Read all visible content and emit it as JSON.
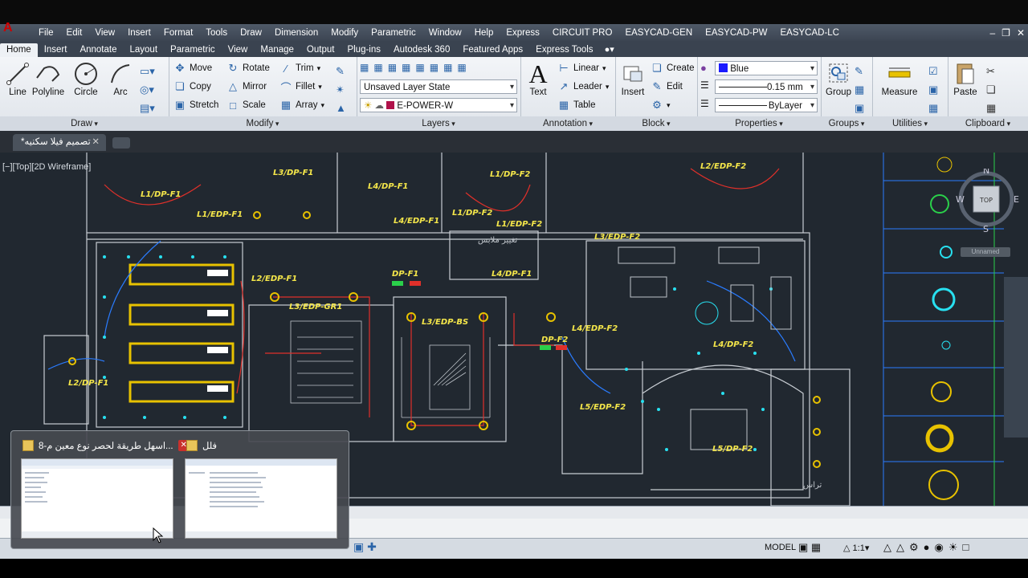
{
  "menu": {
    "items": [
      "File",
      "Edit",
      "View",
      "Insert",
      "Format",
      "Tools",
      "Draw",
      "Dimension",
      "Modify",
      "Parametric",
      "Window",
      "Help",
      "Express",
      "CIRCUIT PRO",
      "EASYCAD-GEN",
      "EASYCAD-PW",
      "EASYCAD-LC"
    ]
  },
  "ribbon_tabs": [
    "Home",
    "Insert",
    "Annotate",
    "Layout",
    "Parametric",
    "View",
    "Manage",
    "Output",
    "Plug-ins",
    "Autodesk 360",
    "Featured Apps",
    "Express Tools"
  ],
  "ribbon": {
    "draw": {
      "title": "Draw",
      "line": "Line",
      "polyline": "Polyline",
      "circle": "Circle",
      "arc": "Arc"
    },
    "modify": {
      "title": "Modify",
      "move": "Move",
      "rotate": "Rotate",
      "trim": "Trim",
      "copy": "Copy",
      "mirror": "Mirror",
      "fillet": "Fillet",
      "stretch": "Stretch",
      "scale": "Scale",
      "array": "Array"
    },
    "layers": {
      "title": "Layers",
      "state": "Unsaved Layer State",
      "current": "E-POWER-W",
      "current_color": "#b0124a"
    },
    "annotation": {
      "title": "Annotation",
      "text": "Text",
      "linear": "Linear",
      "leader": "Leader",
      "table": "Table"
    },
    "block": {
      "title": "Block",
      "insert": "Insert",
      "create": "Create",
      "edit": "Edit"
    },
    "properties": {
      "title": "Properties",
      "color": "Blue",
      "color_hex": "#1a1aff",
      "lineweight": "0.15 mm",
      "linetype": "ByLayer"
    },
    "groups": {
      "title": "Groups",
      "group": "Group"
    },
    "utilities": {
      "title": "Utilities",
      "measure": "Measure"
    },
    "clipboard": {
      "title": "Clipboard",
      "paste": "Paste"
    }
  },
  "document_tab": {
    "title": "*تصميم فيلا سكنيه"
  },
  "viewport": {
    "label": "[−][Top][2D Wireframe]"
  },
  "viewcube": {
    "n": "N",
    "s": "S",
    "e": "E",
    "w": "W",
    "face": "TOP",
    "ucs": "Unnamed"
  },
  "plan_labels": {
    "l3_dp_f1": "L3/DP-F1",
    "l1_dp_f1": "L1/DP-F1",
    "l1_edp_f1": "L1/EDP-F1",
    "l4_dp_f1": "L4/DP-F1",
    "l4_edp_f1": "L4/EDP-F1",
    "l1_dp_f2": "L1/DP-F2",
    "l1_edp_f2": "L1/EDP-F2",
    "l4_dp_f2_top": "L4/DP-F2",
    "l2_edp_f2": "L2/EDP-F2",
    "l3_edp_f2": "L3/EDP-F2",
    "l4_dp_f1b": "L4/DP-F1",
    "l2_edp_f1": "L2/EDP-F1",
    "dp_f1": "DP-F1",
    "l3_edp_gr1": "L3/EDP-GR1",
    "l3_edp_bs": "L3/EDP-BS",
    "l4_edp_f2": "L4/EDP-F2",
    "dp_f2": "DP-F2",
    "l4_dp_f2": "L4/DP-F2",
    "l2_dp_f1": "L2/DP-F1",
    "l5_edp_f2": "L5/EDP-F2",
    "l5_dp_f2": "L5/DP-F2",
    "dressing": "تغيير ملابس",
    "terrace": "تراس"
  },
  "taskbar_preview": {
    "window1": "8-اسهل طريقة لحصر نوع معين م...",
    "window2": "فلل"
  },
  "status": {
    "model": "MODEL",
    "scale": "1:1"
  }
}
